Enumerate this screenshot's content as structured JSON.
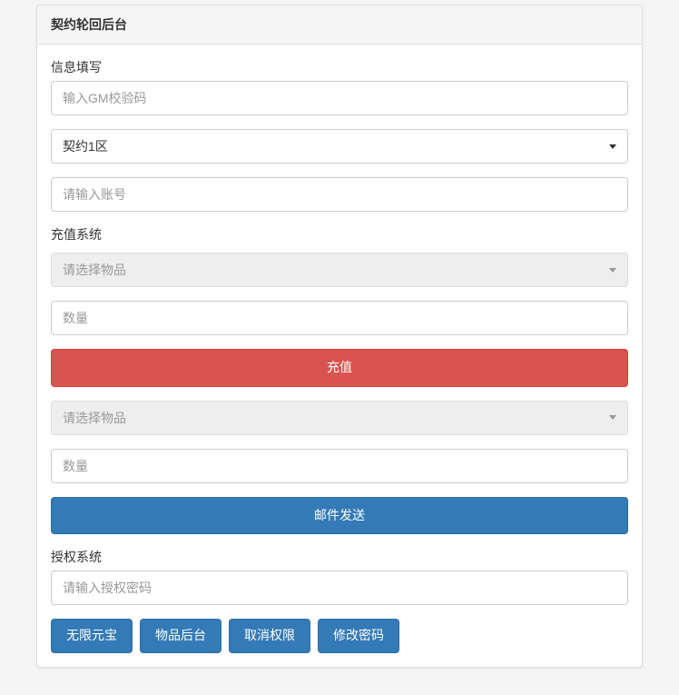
{
  "panel": {
    "title": "契约轮回后台"
  },
  "section_info": {
    "label": "信息填写",
    "gm_code_placeholder": "输入GM校验码",
    "server_selected": "契约1区",
    "account_placeholder": "请输入账号"
  },
  "section_recharge": {
    "label": "充值系统",
    "item1_placeholder": "请选择物品",
    "qty1_placeholder": "数量",
    "recharge_button": "充值",
    "item2_placeholder": "请选择物品",
    "qty2_placeholder": "数量",
    "mail_button": "邮件发送"
  },
  "section_auth": {
    "label": "授权系统",
    "auth_placeholder": "请输入授权密码"
  },
  "buttons": {
    "b1": "无限元宝",
    "b2": "物品后台",
    "b3": "取消权限",
    "b4": "修改密码"
  }
}
